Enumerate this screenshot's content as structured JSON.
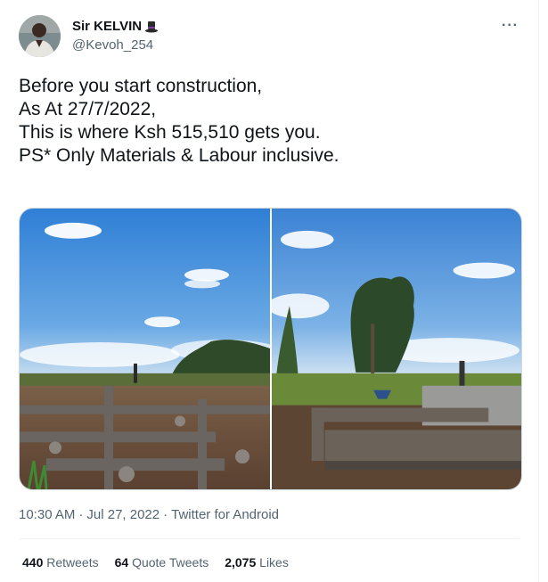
{
  "user": {
    "display_name": "Sir KELVIN",
    "handle": "@Kevoh_254",
    "emoji": "top-hat-icon"
  },
  "menu": {
    "more_label": "···"
  },
  "tweet": {
    "lines": [
      "Before you start construction,",
      "As At 27/7/2022,",
      "This is where Ksh 515,510 gets you.",
      "",
      "PS* Only Materials & Labour inclusive."
    ]
  },
  "meta": {
    "time": "10:30 AM",
    "sep1": "·",
    "date": "Jul 27, 2022",
    "sep2": "·",
    "source": "Twitter for Android"
  },
  "stats": {
    "retweets": {
      "count": "440",
      "label": "Retweets"
    },
    "quotes": {
      "count": "64",
      "label": "Quote Tweets"
    },
    "likes": {
      "count": "2,075",
      "label": "Likes"
    }
  },
  "colors": {
    "text_primary": "#0f1419",
    "text_secondary": "#536471",
    "border": "#eff3f4"
  }
}
